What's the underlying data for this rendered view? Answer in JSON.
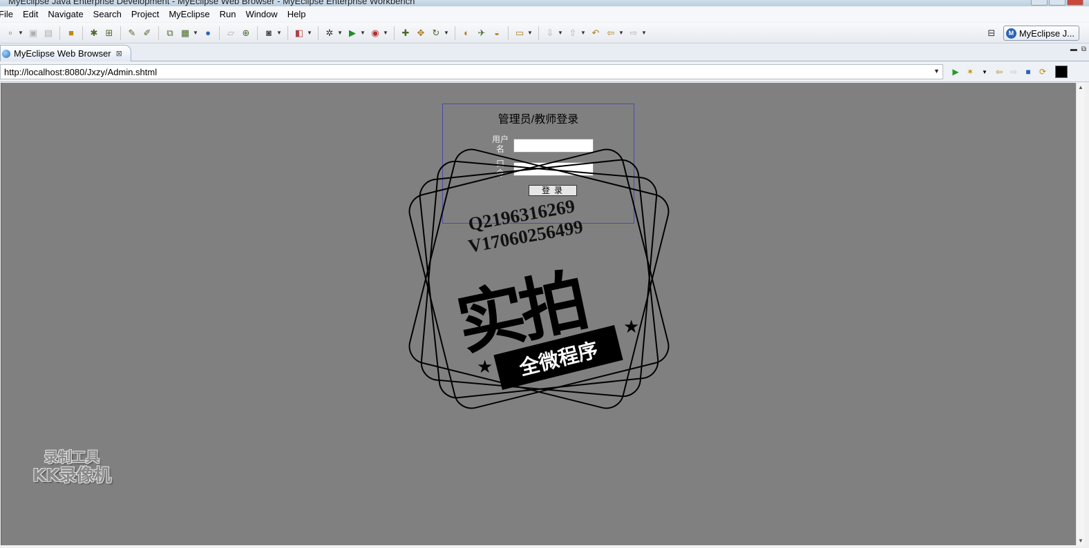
{
  "window": {
    "title": "MyEclipse Java Enterprise Development - MyEclipse Web Browser - MyEclipse Enterprise Workbench"
  },
  "menu": [
    "File",
    "Edit",
    "Navigate",
    "Search",
    "Project",
    "MyEclipse",
    "Run",
    "Window",
    "Help"
  ],
  "perspective": {
    "label": "MyEclipse J...",
    "icon_text": "M"
  },
  "tab": {
    "label": "MyEclipse Web Browser",
    "close_glyph": "⊠"
  },
  "browser": {
    "url": "http://localhost:8080/Jxzy/Admin.shtml"
  },
  "login": {
    "title": "管理员/教师登录",
    "username_label_1": "用户",
    "username_label_2": "名",
    "password_label_1": "口",
    "password_label_2": "令",
    "username_value": "",
    "password_value": "",
    "submit_label": "登录"
  },
  "stamp": {
    "qq": "Q2196316269",
    "wechat": "V17060256499",
    "big_text": "实拍",
    "ribbon_text": "全微程序",
    "star_glyph": "★"
  },
  "recorder_watermark": {
    "line1": "录制工具",
    "line2": "KK录像机"
  },
  "colors": {
    "page_bg": "#808080",
    "login_border": "#4a4aa8",
    "accent": "#2a62b6"
  }
}
